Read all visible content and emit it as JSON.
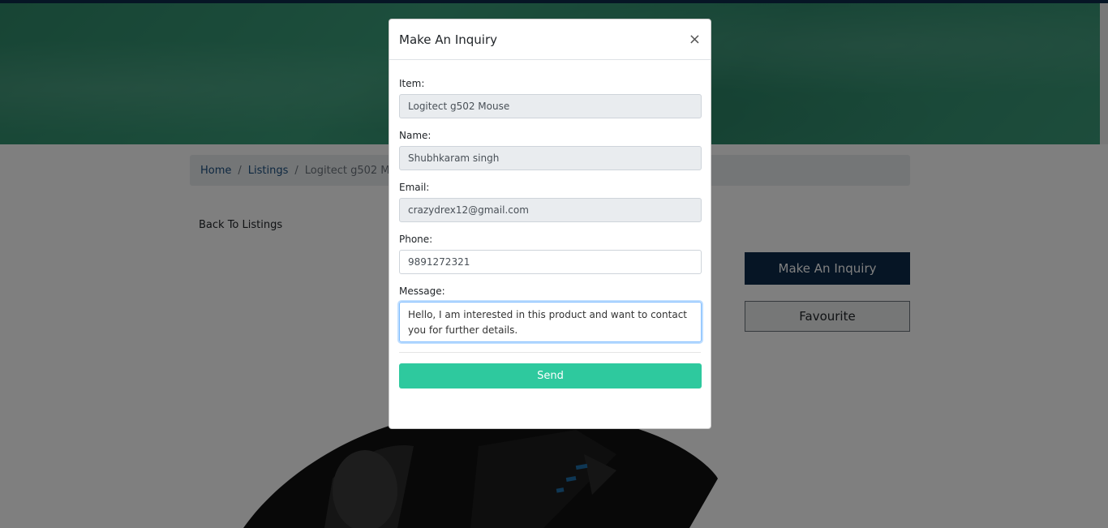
{
  "breadcrumb": {
    "home": "Home",
    "listings": "Listings",
    "current": "Logitect g502 Mouse",
    "separator": "/"
  },
  "page": {
    "back_link": "Back To Listings",
    "inquiry_button": "Make An Inquiry",
    "favourite_button": "Favourite"
  },
  "modal": {
    "title": "Make An Inquiry",
    "close_glyph": "×",
    "item_label": "Item:",
    "item_value": "Logitect g502 Mouse",
    "name_label": "Name:",
    "name_value": "Shubhkaram singh",
    "email_label": "Email:",
    "email_value": "crazydrex12@gmail.com",
    "phone_label": "Phone:",
    "phone_value": "9891272321",
    "message_label": "Message:",
    "message_value": "Hello, I am interested in this product and want to contact you for further details.",
    "send_label": "Send"
  },
  "colors": {
    "primary_navy": "#0c2a4a",
    "send_green": "#2ec99e",
    "hero_green": "#2f8a6a"
  }
}
